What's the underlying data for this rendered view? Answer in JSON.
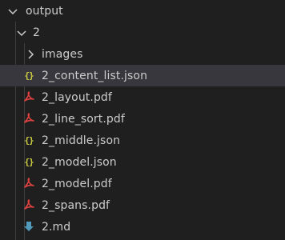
{
  "explorer": {
    "tree": [
      {
        "label": "output",
        "kind": "folder",
        "expanded": true,
        "icon": "chevron-down-icon"
      },
      {
        "label": "2",
        "kind": "folder",
        "expanded": true,
        "icon": "chevron-down-icon"
      },
      {
        "label": "images",
        "kind": "folder",
        "expanded": false,
        "icon": "chevron-right-icon"
      },
      {
        "label": "2_content_list.json",
        "kind": "file",
        "icon": "json-icon",
        "selected": true
      },
      {
        "label": "2_layout.pdf",
        "kind": "file",
        "icon": "pdf-icon"
      },
      {
        "label": "2_line_sort.pdf",
        "kind": "file",
        "icon": "pdf-icon"
      },
      {
        "label": "2_middle.json",
        "kind": "file",
        "icon": "json-icon"
      },
      {
        "label": "2_model.json",
        "kind": "file",
        "icon": "json-icon"
      },
      {
        "label": "2_model.pdf",
        "kind": "file",
        "icon": "pdf-icon"
      },
      {
        "label": "2_spans.pdf",
        "kind": "file",
        "icon": "pdf-icon"
      },
      {
        "label": "2.md",
        "kind": "file",
        "icon": "markdown-icon"
      }
    ]
  },
  "colors": {
    "background": "#1f1f1f",
    "selected_row": "#37373d",
    "text": "#cccccc",
    "json_icon": "#cbcb41",
    "pdf_icon": "#e04141",
    "markdown_icon": "#519aba",
    "indent_guide": "#3e3e3e"
  }
}
